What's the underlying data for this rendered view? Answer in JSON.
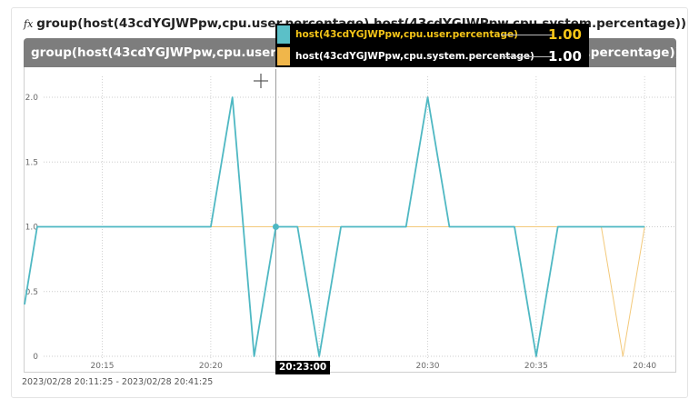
{
  "widget": {
    "fx_symbol": "fx",
    "title": "group(host(43cdYGJWPpw,cpu.user.percentage) host(43cdYGJWPpw,cpu.system.percentage))",
    "panel_label": "group(host(43cdYGJWPpw,cpu.user.percentage) host(43cdYGJWPpw,cpu.system.percentage))",
    "time_range": "2023/02/28 20:11:25 - 2023/02/28 20:41:25"
  },
  "crosshair": {
    "time_label": "20:23:00"
  },
  "tooltip": {
    "rows": [
      {
        "name": "host(43cdYGJWPpw,cpu.user.percentage)",
        "value": "1.00",
        "color": "#5bc0c8",
        "text_color": "#f5c518"
      },
      {
        "name": "host(43cdYGJWPpw,cpu.system.percentage)",
        "value": "1.00",
        "color": "#f0b64a",
        "text_color": "#ffffff"
      }
    ]
  },
  "chart_data": {
    "type": "line",
    "x_ticks": [
      "20:15",
      "20:20",
      "20:25",
      "20:30",
      "20:35",
      "20:40"
    ],
    "y_ticks": [
      "0",
      "0.5",
      "1.0",
      "1.5",
      "2.0"
    ],
    "ylim": [
      0,
      2.2
    ],
    "grid": true,
    "series": [
      {
        "name": "host(43cdYGJWPpw,cpu.user.percentage)",
        "color": "#4fb8c3",
        "points": [
          [
            "20:11:25",
            0.4
          ],
          [
            "20:12:00",
            1.0
          ],
          [
            "20:13:00",
            1.0
          ],
          [
            "20:14:00",
            1.0
          ],
          [
            "20:15:00",
            1.0
          ],
          [
            "20:16:00",
            1.0
          ],
          [
            "20:17:00",
            1.0
          ],
          [
            "20:18:00",
            1.0
          ],
          [
            "20:19:00",
            1.0
          ],
          [
            "20:20:00",
            1.0
          ],
          [
            "20:21:00",
            2.0
          ],
          [
            "20:22:00",
            0.0
          ],
          [
            "20:23:00",
            1.0
          ],
          [
            "20:24:00",
            1.0
          ],
          [
            "20:25:00",
            0.0
          ],
          [
            "20:26:00",
            1.0
          ],
          [
            "20:27:00",
            1.0
          ],
          [
            "20:28:00",
            1.0
          ],
          [
            "20:29:00",
            1.0
          ],
          [
            "20:30:00",
            2.0
          ],
          [
            "20:31:00",
            1.0
          ],
          [
            "20:32:00",
            1.0
          ],
          [
            "20:33:00",
            1.0
          ],
          [
            "20:34:00",
            1.0
          ],
          [
            "20:35:00",
            0.0
          ],
          [
            "20:36:00",
            1.0
          ],
          [
            "20:37:00",
            1.0
          ],
          [
            "20:38:00",
            1.0
          ],
          [
            "20:39:00",
            1.0
          ],
          [
            "20:40:00",
            1.0
          ]
        ]
      },
      {
        "name": "host(43cdYGJWPpw,cpu.system.percentage)",
        "color": "#f3c97a",
        "points": [
          [
            "20:12:00",
            1.0
          ],
          [
            "20:20:00",
            1.0
          ],
          [
            "20:23:00",
            1.0
          ],
          [
            "20:38:00",
            1.0
          ],
          [
            "20:39:00",
            0.0
          ],
          [
            "20:40:00",
            1.0
          ]
        ]
      }
    ]
  }
}
